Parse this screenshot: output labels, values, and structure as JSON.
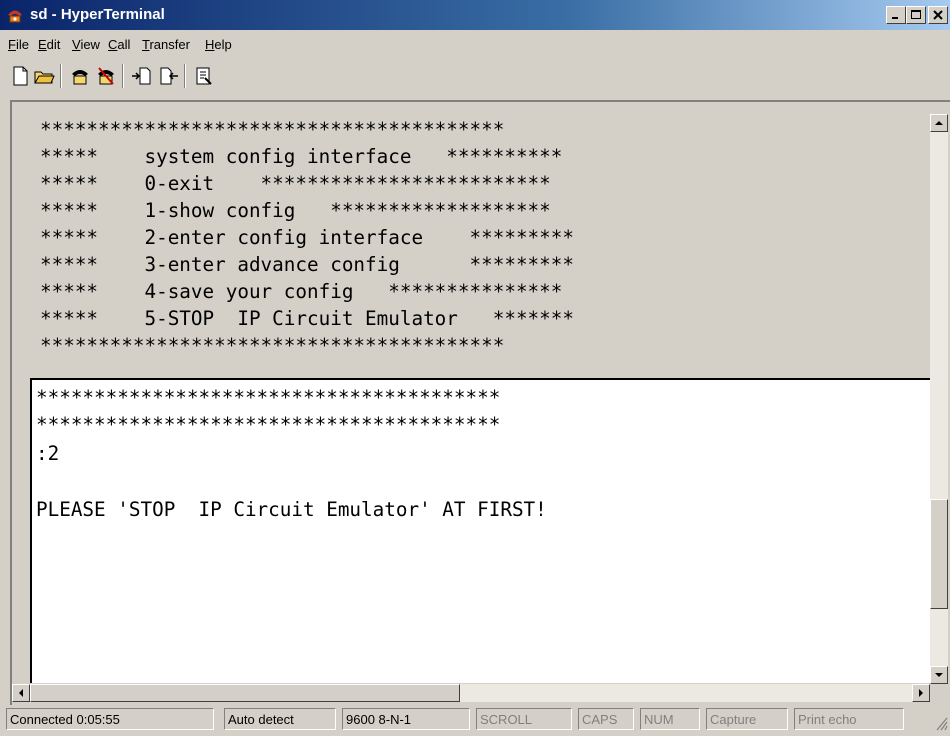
{
  "window": {
    "title": "sd - HyperTerminal",
    "icon": "hyperterminal-phone-icon"
  },
  "caption_buttons": [
    "minimize-icon",
    "maximize-icon",
    "close-icon"
  ],
  "menu": {
    "items": [
      {
        "label": "File",
        "mnemonic": "F",
        "rest": "ile"
      },
      {
        "label": "Edit",
        "mnemonic": "E",
        "rest": "dit"
      },
      {
        "label": "View",
        "mnemonic": "V",
        "rest": "iew"
      },
      {
        "label": "Call",
        "mnemonic": "C",
        "rest": "all"
      },
      {
        "label": "Transfer",
        "mnemonic": "T",
        "rest": "ransfer"
      },
      {
        "label": "Help",
        "mnemonic": "H",
        "rest": "elp"
      }
    ]
  },
  "toolbar": {
    "icons": [
      "new-document-icon",
      "open-folder-icon",
      "call-icon",
      "disconnect-icon",
      "send-file-icon",
      "receive-file-icon",
      "properties-icon"
    ]
  },
  "terminal": {
    "scrollback_lines": [
      "****************************************",
      "*****    system config interface   **********",
      "*****    0-exit    *************************",
      "*****    1-show config   *******************",
      "*****    2-enter config interface    *********",
      "*****    3-enter advance config      *********",
      "*****    4-save your config   ***************",
      "*****    5-STOP  IP Circuit Emulator   *******",
      "****************************************"
    ],
    "screen_lines": [
      "****************************************",
      "****************************************",
      ":2",
      "",
      "PLEASE 'STOP  IP Circuit Emulator' AT FIRST!"
    ]
  },
  "status": {
    "connected": "Connected 0:05:55",
    "detect": "Auto detect",
    "port": "9600 8-N-1",
    "scroll": "SCROLL",
    "caps": "CAPS",
    "num": "NUM",
    "capture": "Capture",
    "print_echo": "Print echo"
  },
  "colors": {
    "title_active": "#0a246a",
    "face": "#d4d0c8",
    "terminal_bg": "#ffffff"
  }
}
